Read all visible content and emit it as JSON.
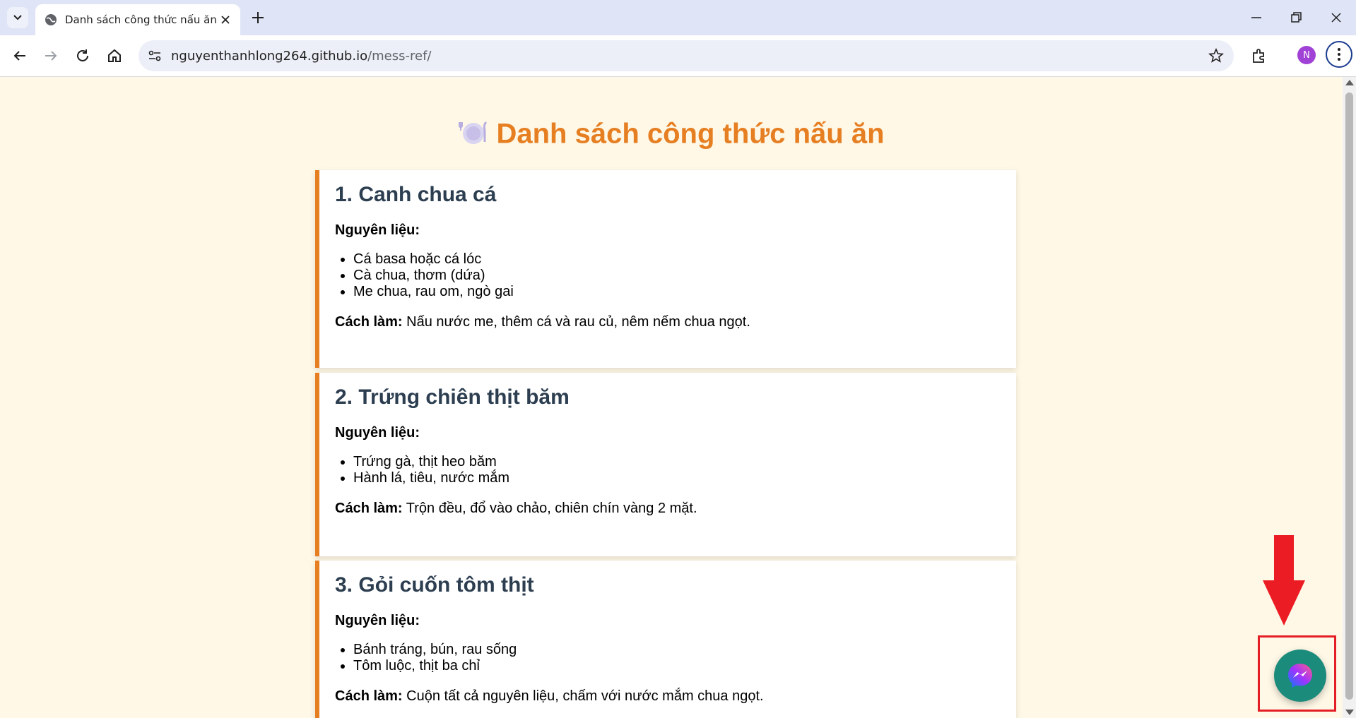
{
  "browser": {
    "tab_title": "Danh sách công thức nấu ăn",
    "url_host": "nguyenthanhlong264.github.io",
    "url_path": "/mess-ref/",
    "profile_initial": "N"
  },
  "page": {
    "title_emoji": "🍽️",
    "title": "Danh sách công thức nấu ăn",
    "accent_color": "#e67e22",
    "recipes": [
      {
        "name": "1. Canh chua cá",
        "ingredients_label": "Nguyên liệu:",
        "ingredients": [
          "Cá basa hoặc cá lóc",
          "Cà chua, thơm (dứa)",
          "Me chua, rau om, ngò gai"
        ],
        "method_label": "Cách làm:",
        "method": "Nấu nước me, thêm cá và rau củ, nêm nếm chua ngọt."
      },
      {
        "name": "2. Trứng chiên thịt băm",
        "ingredients_label": "Nguyên liệu:",
        "ingredients": [
          "Trứng gà, thịt heo băm",
          "Hành lá, tiêu, nước mắm"
        ],
        "method_label": "Cách làm:",
        "method": "Trộn đều, đổ vào chảo, chiên chín vàng 2 mặt."
      },
      {
        "name": "3. Gỏi cuốn tôm thịt",
        "ingredients_label": "Nguyên liệu:",
        "ingredients": [
          "Bánh tráng, bún, rau sống",
          "Tôm luộc, thịt ba chỉ"
        ],
        "method_label": "Cách làm:",
        "method": "Cuộn tất cả nguyên liệu, chấm với nước mắm chua ngọt."
      }
    ]
  },
  "icons": {
    "tab_list": "chevron-down-icon",
    "favicon": "globe-icon",
    "messenger": "messenger-icon"
  }
}
